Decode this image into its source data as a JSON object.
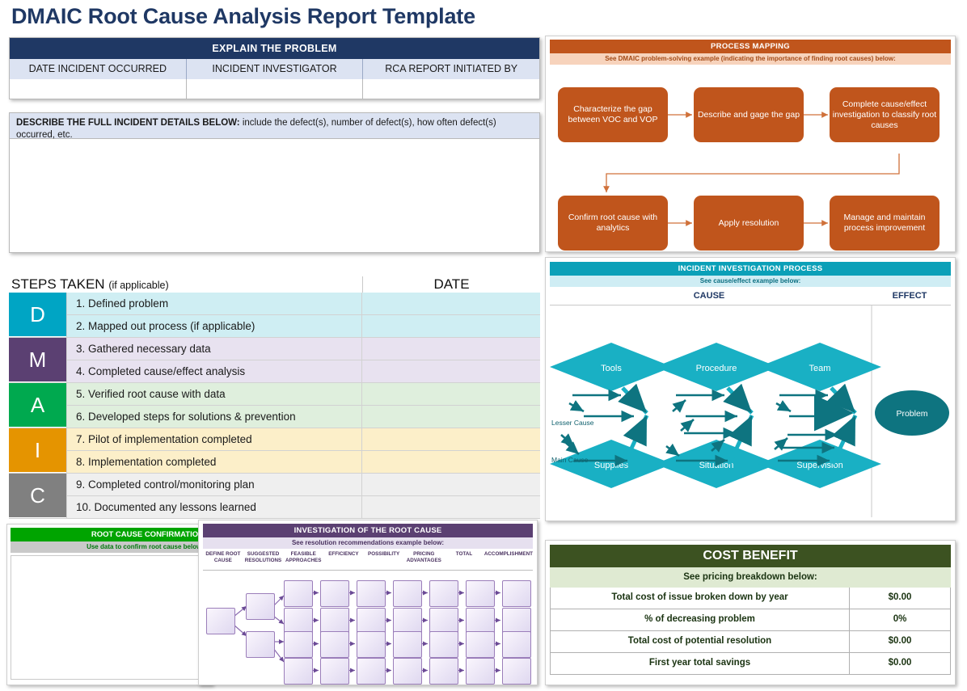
{
  "page": {
    "title": "DMAIC Root Cause Analysis Report Template"
  },
  "explain": {
    "header": "EXPLAIN THE PROBLEM",
    "columns": [
      "DATE INCIDENT OCCURRED",
      "INCIDENT INVESTIGATOR",
      "RCA REPORT INITIATED BY"
    ],
    "values": [
      "",
      "",
      ""
    ]
  },
  "describe": {
    "label": "DESCRIBE THE FULL INCIDENT DETAILS BELOW:",
    "hint": "include the defect(s), number of defect(s), how often defect(s) occurred, etc.",
    "value": ""
  },
  "steps": {
    "title": "STEPS TAKEN",
    "title_note": "(if applicable)",
    "date_header": "DATE",
    "groups": [
      {
        "letter": "D",
        "color": "#00A5C4",
        "row_color": "#CFEEF3",
        "rows": [
          {
            "task": "1. Defined problem",
            "date": ""
          },
          {
            "task": "2. Mapped out process (if applicable)",
            "date": ""
          }
        ]
      },
      {
        "letter": "M",
        "color": "#5B4072",
        "row_color": "#E8E2F0",
        "rows": [
          {
            "task": "3. Gathered necessary data",
            "date": ""
          },
          {
            "task": "4. Completed cause/effect analysis",
            "date": ""
          }
        ]
      },
      {
        "letter": "A",
        "color": "#00A94F",
        "row_color": "#DFEFDD",
        "rows": [
          {
            "task": "5. Verified root cause with data",
            "date": ""
          },
          {
            "task": "6. Developed steps for solutions & prevention",
            "date": ""
          }
        ]
      },
      {
        "letter": "I",
        "color": "#E59400",
        "row_color": "#FCEFC9",
        "rows": [
          {
            "task": "7. Pilot of implementation completed",
            "date": ""
          },
          {
            "task": "8. Implementation completed",
            "date": ""
          }
        ]
      },
      {
        "letter": "C",
        "color": "#808080",
        "row_color": "#EFEFEF",
        "rows": [
          {
            "task": "9. Completed control/monitoring plan",
            "date": ""
          },
          {
            "task": "10. Documented any lessons learned",
            "date": ""
          }
        ]
      }
    ]
  },
  "process_mapping": {
    "header": "PROCESS MAPPING",
    "subheader": "See DMAIC problem-solving example (indicating the importance of finding root causes) below:",
    "accent": "#C0551C",
    "boxes": [
      "Characterize the gap between VOC and VOP",
      "Describe and gage the gap",
      "Complete cause/effect investigation to classify root causes",
      "Confirm root cause with analytics",
      "Apply resolution",
      "Manage and maintain process improvement"
    ]
  },
  "fishbone": {
    "header": "INCIDENT INVESTIGATION PROCESS",
    "subheader": "See cause/effect example below:",
    "accent": "#0BA0B8",
    "cause_label": "CAUSE",
    "effect_label": "EFFECT",
    "top_categories": [
      "Tools",
      "Procedure",
      "Team"
    ],
    "bottom_categories": [
      "Supplies",
      "Situation",
      "Supervision"
    ],
    "effect_node": "Problem",
    "annotations": [
      "Lesser Cause",
      "Main Cause"
    ]
  },
  "root_cause_confirmation": {
    "header": "ROOT CAUSE CONFIRMATION",
    "subheader": "Use data to confirm root cause below:",
    "accent": "#00A400",
    "value": ""
  },
  "investigation": {
    "header": "INVESTIGATION OF THE ROOT CAUSE",
    "subheader": "See resolution recommendations example below:",
    "accent": "#5B4072",
    "columns": [
      "DEFINE ROOT CAUSE",
      "SUGGESTED RESOLUTIONS",
      "FEASIBLE APPROACHES",
      "EFFICIENCY",
      "POSSIBILITY",
      "PRICING ADVANTAGES",
      "TOTAL",
      "ACCOMPLISHMENT"
    ]
  },
  "cost_benefit": {
    "header": "COST BENEFIT",
    "subheader": "See pricing breakdown below:",
    "accent": "#3C5221",
    "rows": [
      {
        "label": "Total cost of issue broken down by year",
        "value": "$0.00"
      },
      {
        "label": "% of decreasing problem",
        "value": "0%"
      },
      {
        "label": "Total cost of potential resolution",
        "value": "$0.00"
      },
      {
        "label": "First year total savings",
        "value": "$0.00"
      }
    ]
  }
}
